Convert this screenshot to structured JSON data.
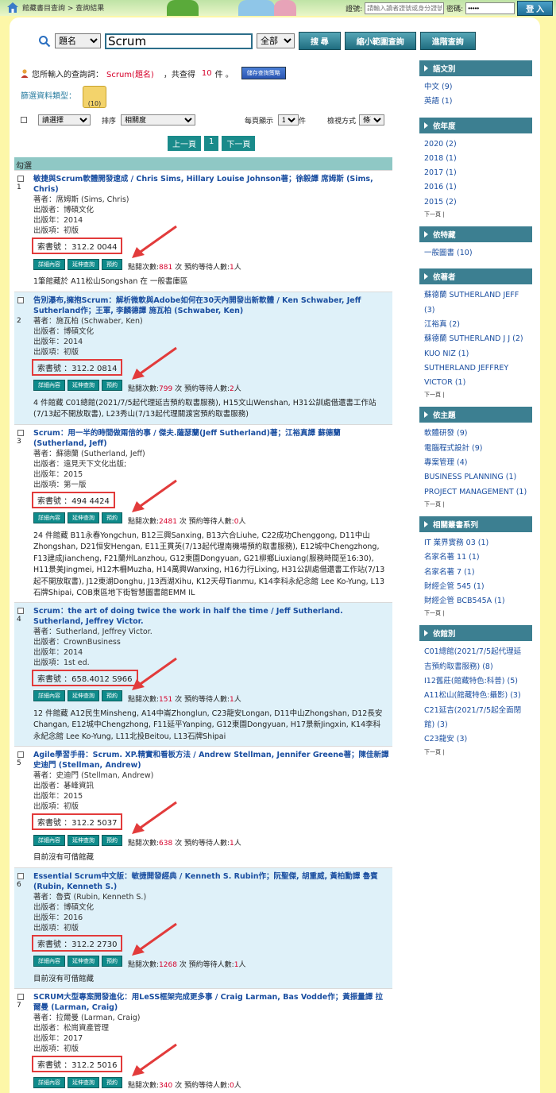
{
  "topbar": {
    "breadcrumb": "館藏書目查詢 > 查詢結果",
    "login": {
      "card_label": "證號:",
      "card_placeholder": "請輸入讀者證號或身分證號",
      "password_label": "密碼:",
      "password_value": "•••••",
      "login_button": "登 入"
    }
  },
  "search": {
    "field": "題名",
    "query": "Scrum",
    "scope": "全部",
    "search_button": "搜 尋",
    "narrow_button": "縮小範圍查詢",
    "advanced_button": "進階查詢"
  },
  "summary": {
    "prefix": "您所輸入的查詢詞：",
    "term": "Scrum(題名)",
    "middle": "，共查得",
    "count": "10",
    "suffix": "件 。",
    "save_button": "儲存查詢策略"
  },
  "filter": {
    "label": "篩選資料類型：",
    "book_count": "(10)"
  },
  "options": {
    "select_default": "請選擇",
    "sort_label": "排序",
    "sort_value": "相關度",
    "per_page_label": "每頁顯示",
    "per_page_value": "10",
    "per_page_unit": "件",
    "view_label": "檢視方式",
    "view_value": "條列"
  },
  "pager": {
    "prev": "上一頁",
    "page": "1",
    "next": "下一頁"
  },
  "results_header": "勾選",
  "labels": {
    "author": "著者：",
    "publisher": "出版者：",
    "year": "出版年：",
    "edition": "出版項：",
    "callno": "索書號 ：",
    "detail": "詳細內容",
    "renew": "延伸查詢",
    "reserve": "預約",
    "clicks": "點閱次數:",
    "clicks_unit": "次",
    "holds": "預約等待人數:",
    "holds_unit": "人"
  },
  "records": [
    {
      "num": "1",
      "title": "敏捷與Scrum軟體開發速成 / Chris Sims, Hillary Louise Johnson著；徐毅譯 席姆斯 (Sims, Chris)",
      "author": "席姆斯 (Sims, Chris)",
      "publisher": "博碩文化",
      "year": "2014",
      "edition": "初版",
      "callno": "312.2 0044",
      "clicks": "881",
      "holds": "1",
      "holdings": "1筆館藏於 A11松山Songshan 在 一般書庫區"
    },
    {
      "num": "2",
      "title": "告別瀑布,擁抱Scrum：解析微軟與Adobe如何在30天內開發出新軟體 / Ken Schwaber, Jeff Sutherland作；王軍, 李麟德譯 施瓦柏 (Schwaber, Ken)",
      "author": "施瓦柏 (Schwaber, Ken)",
      "publisher": "博碩文化",
      "year": "2014",
      "edition": "初版",
      "callno": "312.2 0814",
      "clicks": "799",
      "holds": "2",
      "holdings": "4 件館藏 C01總館(2021/7/5起代理延吉預約取書服務), H15文山Wenshan, H31公訓處借還書工作站(7/13起不開放取書), L23秀山(7/13起代理關渡宮預約取書服務)"
    },
    {
      "num": "3",
      "title": "Scrum：用一半的時間做兩倍的事 / 傑夫.薩瑟蘭(Jeff Sutherland)著；江裕真譯 蘇德蘭 (Sutherland, Jeff)",
      "author": "蘇德蘭 (Sutherland, Jeff)",
      "publisher": "遠見天下文化出版;",
      "year": "2015",
      "edition": "第一版",
      "callno": "494 4424",
      "clicks": "2481",
      "holds": "0",
      "holdings": "24 件館藏 B11永春Yongchun, B12三興Sanxing, B13六合Liuhe, C22成功Chenggong, D11中山Zhongshan, D21恒安Hengan, E11王貫英(7/13起代理南機場預約取書服務), E12城中Chengzhong, F13建成Jiancheng, F21蘭州Lanzhou, G12東園Dongyuan, G21柳鄉Liuxiang(服務時間至16:30), H11景美Jingmei, H12木柵Muzha, H14萬興Wanxing, H16力行Lixing, H31公訓處借還書工作站(7/13起不開放取書), J12東湖Donghu, J13西湖Xihu, K12天母Tianmu, K14李科永紀念館 Lee Ko-Yung, L13石牌Shipai, COB東區地下街智慧圖書館EMM IL"
    },
    {
      "num": "4",
      "title": "Scrum：the art of doing twice the work in half the time / Jeff Sutherland. Sutherland, Jeffrey Victor.",
      "author": "Sutherland, Jeffrey Victor.",
      "publisher": "CrownBusiness",
      "year": "2014",
      "edition": "1st ed.",
      "callno": "658.4012 S966",
      "clicks": "151",
      "holds": "1",
      "holdings": "12 件館藏 A12民生Minsheng, A14中崙Zhonglun, C23龍安Longan, D11中山Zhongshan, D12長安Changan, E12城中Chengzhong, F11延平Yanping, G12東園Dongyuan, H17景新Jingxin, K14李科永紀念館 Lee Ko-Yung, L11北投Beitou, L13石牌Shipai"
    },
    {
      "num": "5",
      "title": "Agile學習手冊：Scrum. XP.精實和看板方法 / Andrew Stellman, Jennifer Greene著；陳佳新譯 史迪門 (Stellman, Andrew)",
      "author": "史迪門 (Stellman, Andrew)",
      "publisher": "碁峰資訊",
      "year": "2015",
      "edition": "初版",
      "callno": "312.2 5037",
      "clicks": "638",
      "holds": "1",
      "holdings": "目前沒有可借館藏"
    },
    {
      "num": "6",
      "title": "Essential Scrum中文版：敏捷開發經典 / Kenneth S. Rubin作；阮聖傑, 胡重威, 黃柏勳譯 魯賓 (Rubin, Kenneth S.)",
      "author": "魯賓 (Rubin, Kenneth S.)",
      "publisher": "博碩文化",
      "year": "2016",
      "edition": "初版",
      "callno": "312.2 2730",
      "clicks": "1268",
      "holds": "1",
      "holdings": "目前沒有可借館藏"
    },
    {
      "num": "7",
      "title": "SCRUM大型專案開發進化：用LeSS框架完成更多事 / Craig Larman, Bas Vodde作；黃振量譯 拉爾曼 (Larman, Craig)",
      "author": "拉爾曼 (Larman, Craig)",
      "publisher": "松崗資產管理",
      "year": "2017",
      "edition": "初版",
      "callno": "312.2 5016",
      "clicks": "340",
      "holds": "0",
      "holdings": ""
    }
  ],
  "sidebar": {
    "more": "下一頁",
    "sections": [
      {
        "title": "語文別",
        "items": [
          "中文 (9)",
          "英語 (1)"
        ],
        "more": false
      },
      {
        "title": "依年度",
        "items": [
          "2020 (2)",
          "2018 (1)",
          "2017 (1)",
          "2016 (1)",
          "2015 (2)"
        ],
        "more": true
      },
      {
        "title": "依特藏",
        "items": [
          "一般圖書 (10)"
        ],
        "more": false
      },
      {
        "title": "依著者",
        "items": [
          "蘇德蘭 SUTHERLAND JEFF (3)",
          "江裕真 (2)",
          "蘇德蘭 SUTHERLAND J J (2)",
          "KUO NIZ (1)",
          "SUTHERLAND JEFFREY VICTOR (1)"
        ],
        "more": true
      },
      {
        "title": "依主題",
        "items": [
          "軟體研發 (9)",
          "電腦程式設計 (9)",
          "專案管理 (4)",
          "BUSINESS PLANNING (1)",
          "PROJECT MANAGEMENT (1)"
        ],
        "more": true
      },
      {
        "title": "相關叢書系列",
        "items": [
          "IT 業界實務 03 (1)",
          "名家名著 11 (1)",
          "名家名著 7 (1)",
          "財經企管 545 (1)",
          "財經企管 BCB545A (1)"
        ],
        "more": true
      },
      {
        "title": "依館別",
        "items": [
          "C01總館(2021/7/5起代理延吉預約取書服務) (8)",
          "I12舊莊(館藏特色:科普) (5)",
          "A11松山(館藏特色:攝影) (3)",
          "C21延吉(2021/7/5起全面閉館) (3)",
          "C23龍安 (3)"
        ],
        "more": true
      }
    ]
  }
}
